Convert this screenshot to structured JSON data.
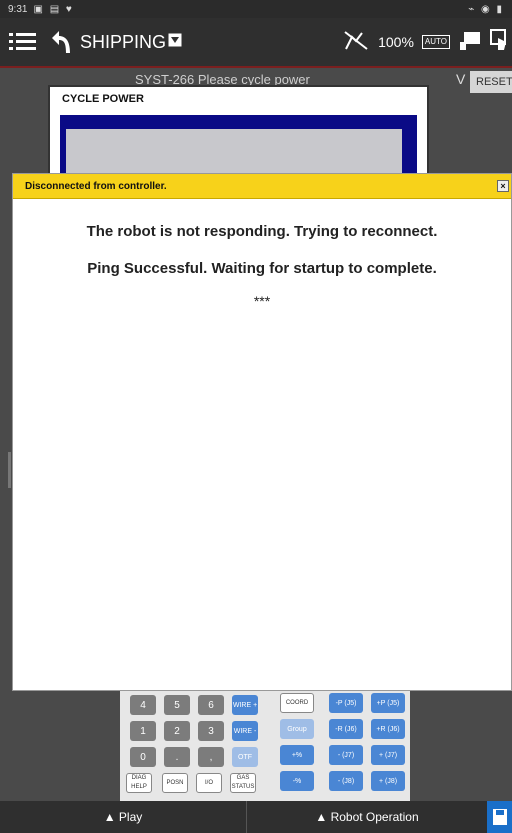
{
  "status_bar": {
    "time": "9:31",
    "left_icons": "▣ ▤ ♥",
    "right_icons": "⌁ ◉ ▮"
  },
  "top_bar": {
    "title": "SHIPPING",
    "speed": "100%",
    "auto_label": "AUTO",
    "icons": [
      "menu-icon",
      "back-icon",
      "no-motion-icon",
      "auto-mode-icon",
      "pendant-icon",
      "touch-icon"
    ]
  },
  "background_app": {
    "alarm_text": "SYST-266 Please cycle power",
    "expand_glyph": "V",
    "reset_label": "RESET",
    "window_title": "CYCLE POWER"
  },
  "dialog": {
    "header": "Disconnected from controller.",
    "close_glyph": "×",
    "line1": "The robot is not responding. Trying to reconnect.",
    "line2": "Ping Successful. Waiting for startup to complete.",
    "line3": "***",
    "header_color": "#f7d21a"
  },
  "keypad": {
    "row1": [
      "4",
      "5",
      "6",
      "WIRE +",
      "COORD",
      "-P (J5)",
      "+P (J5)"
    ],
    "row2": [
      "1",
      "2",
      "3",
      "WIRE -",
      "Group",
      "-R (J6)",
      "+R (J6)"
    ],
    "row3": [
      "0",
      ".",
      ",",
      "OTF",
      "+%",
      "- (J7)",
      "+ (J7)"
    ],
    "row4": [
      "DIAG HELP",
      "POSN",
      "I/O",
      "GAS STATUS",
      "-%",
      "- (J8)",
      "+ (J8)"
    ]
  },
  "bottom_bar": {
    "play_label": "▲ Play",
    "robot_label": "▲ Robot Operation"
  }
}
